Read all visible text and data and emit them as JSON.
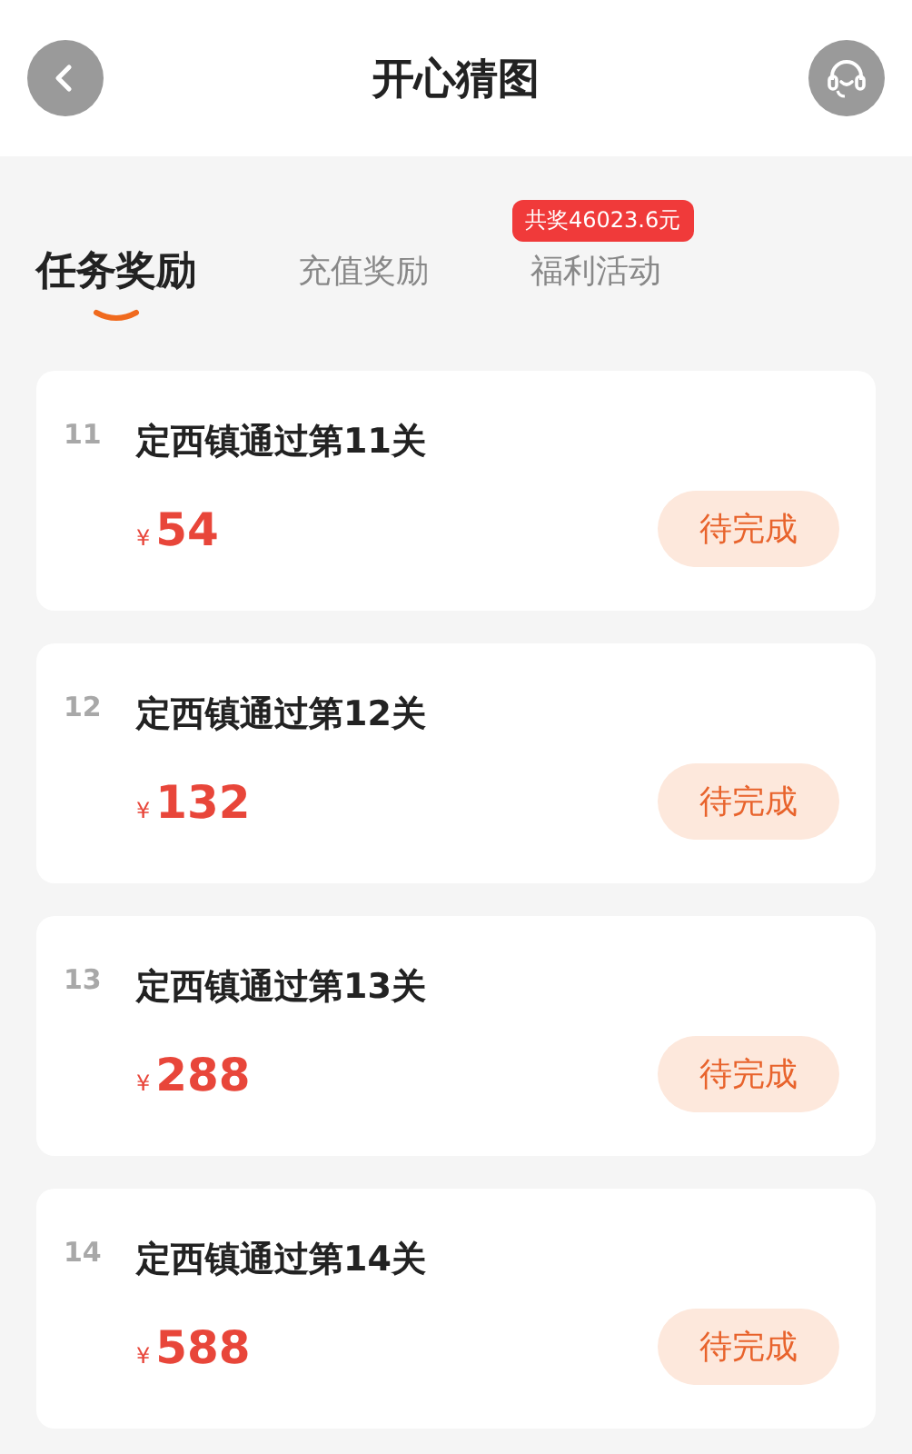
{
  "header": {
    "title": "开心猜图"
  },
  "tabs": [
    {
      "label": "任务奖励",
      "selected": true
    },
    {
      "label": "充值奖励",
      "selected": false
    },
    {
      "label": "福利活动",
      "selected": false,
      "badge": "共奖46023.6元"
    }
  ],
  "tasks": [
    {
      "index": "11",
      "title": "定西镇通过第11关",
      "currency": "¥",
      "amount": "54",
      "status": "待完成"
    },
    {
      "index": "12",
      "title": "定西镇通过第12关",
      "currency": "¥",
      "amount": "132",
      "status": "待完成"
    },
    {
      "index": "13",
      "title": "定西镇通过第13关",
      "currency": "¥",
      "amount": "288",
      "status": "待完成"
    },
    {
      "index": "14",
      "title": "定西镇通过第14关",
      "currency": "¥",
      "amount": "588",
      "status": "待完成"
    }
  ]
}
